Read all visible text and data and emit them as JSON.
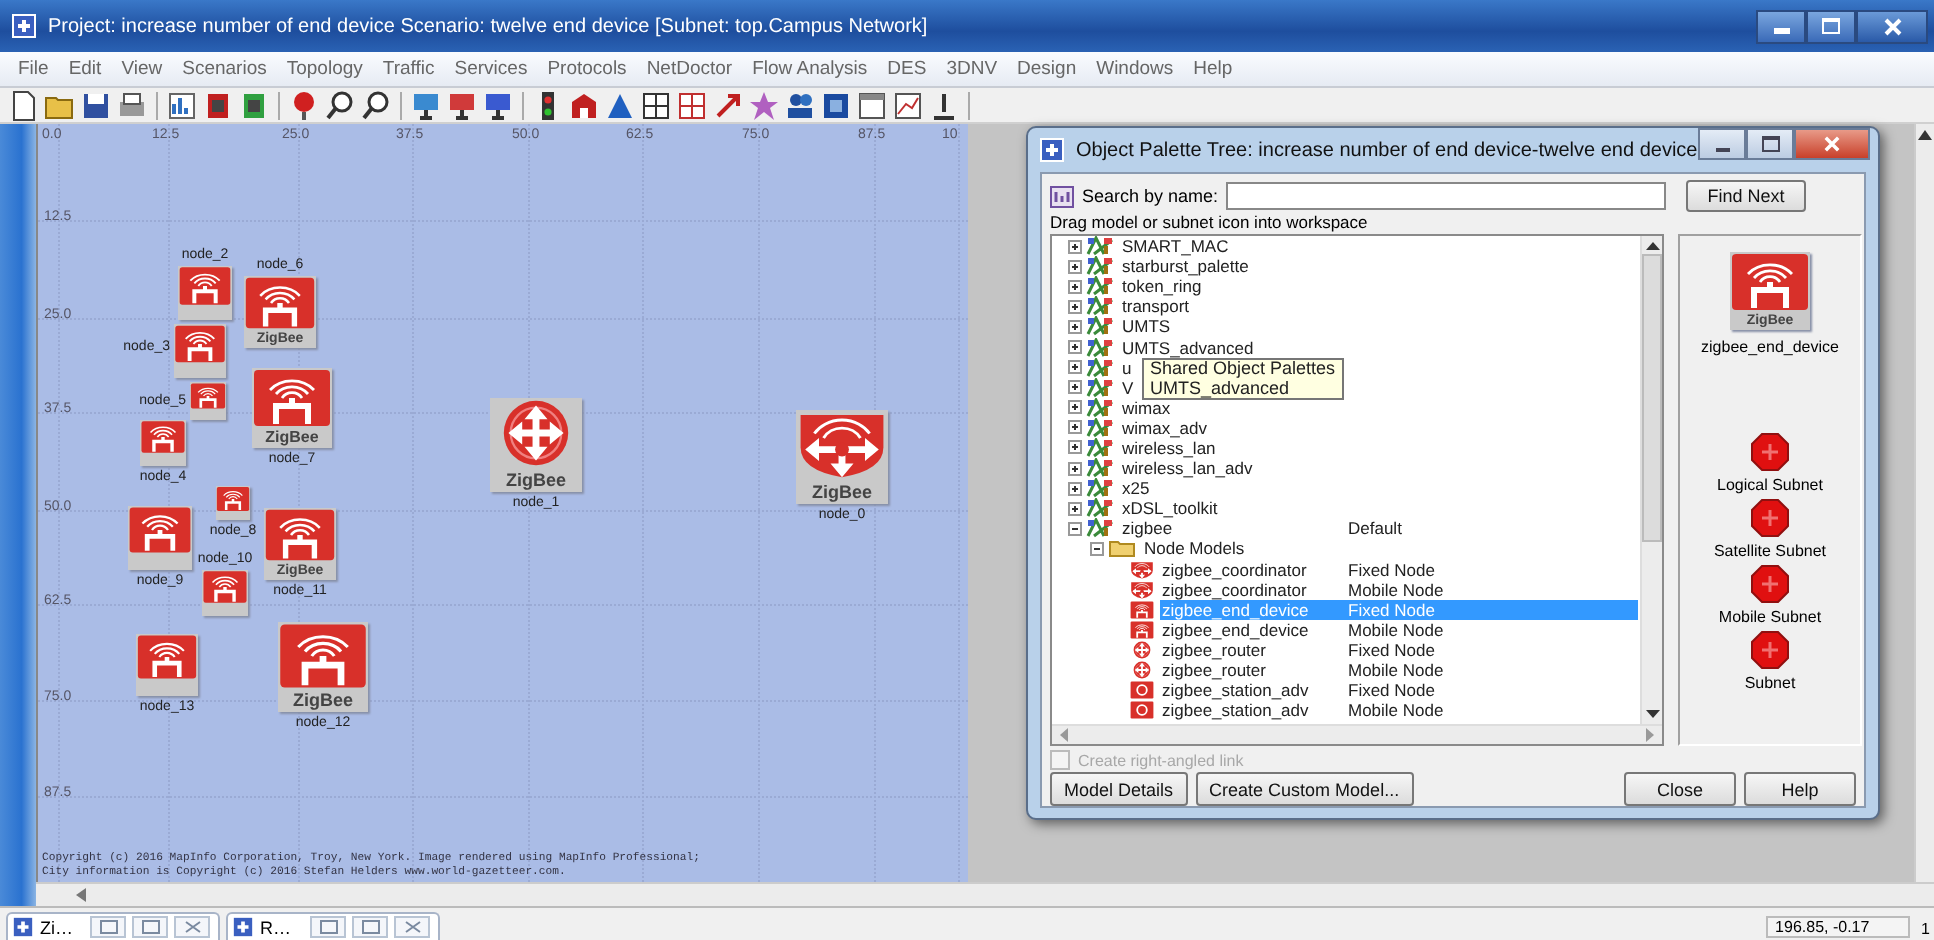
{
  "window": {
    "title": "Project: increase number of end device Scenario: twelve end device  [Subnet: top.Campus Network]"
  },
  "menu": [
    "File",
    "Edit",
    "View",
    "Scenarios",
    "Topology",
    "Traffic",
    "Services",
    "Protocols",
    "NetDoctor",
    "Flow Analysis",
    "DES",
    "3DNV",
    "Design",
    "Windows",
    "Help"
  ],
  "canvas": {
    "x_ticks": [
      "0.0",
      "12.5",
      "25.0",
      "37.5",
      "50.0",
      "62.5",
      "75.0",
      "87.5",
      "10"
    ],
    "y_ticks": [
      "12.5",
      "25.0",
      "37.5",
      "50.0",
      "62.5",
      "75.0",
      "87.5"
    ],
    "nodes": [
      {
        "label": "node_2",
        "kind": "end_device"
      },
      {
        "label": "node_6",
        "kind": "end_device",
        "badge": "ZigBee"
      },
      {
        "label": "node_3",
        "kind": "end_device"
      },
      {
        "label": "node_5",
        "kind": "end_device"
      },
      {
        "label": "node_7",
        "kind": "end_device",
        "badge": "ZigBee"
      },
      {
        "label": "node_4",
        "kind": "end_device"
      },
      {
        "label": "node_1",
        "kind": "router",
        "badge": "ZigBee"
      },
      {
        "label": "node_0",
        "kind": "coordinator",
        "badge": "ZigBee"
      },
      {
        "label": "node_8",
        "kind": "end_device"
      },
      {
        "label": "node_9",
        "kind": "end_device"
      },
      {
        "label": "node_10",
        "kind": "end_device"
      },
      {
        "label": "node_11",
        "kind": "end_device",
        "badge": "ZigBee"
      },
      {
        "label": "node_13",
        "kind": "end_device"
      },
      {
        "label": "node_12",
        "kind": "end_device",
        "badge": "ZigBee"
      }
    ],
    "copyright": [
      "Copyright (c) 2016 MapInfo Corporation, Troy, New York. Image rendered using MapInfo Professional;",
      "City information is Copyright (c) 2016 Stefan Helders www.world-gazetteer.com."
    ]
  },
  "palette_dialog": {
    "title": "Object Palette Tree: increase number of end device-twelve end device",
    "search_label": "Search by name:",
    "find_button": "Find Next",
    "hint": "Drag model or subnet icon into workspace",
    "tree": [
      {
        "label": "SMART_MAC",
        "kind": "palette",
        "expanded": false,
        "selected": false
      },
      {
        "label": "starburst_palette",
        "kind": "palette",
        "expanded": false,
        "selected": false
      },
      {
        "label": "token_ring",
        "kind": "palette",
        "expanded": false,
        "selected": false
      },
      {
        "label": "transport",
        "kind": "palette",
        "expanded": false,
        "selected": false
      },
      {
        "label": "UMTS",
        "kind": "palette",
        "expanded": false,
        "selected": false
      },
      {
        "label": "UMTS_advanced",
        "kind": "palette",
        "expanded": false,
        "selected": false
      },
      {
        "label": "u",
        "kind": "palette",
        "expanded": false,
        "selected": false
      },
      {
        "label": "V",
        "kind": "palette",
        "expanded": false,
        "selected": false
      },
      {
        "label": "wimax",
        "kind": "palette",
        "expanded": false,
        "selected": false
      },
      {
        "label": "wimax_adv",
        "kind": "palette",
        "expanded": false,
        "selected": false
      },
      {
        "label": "wireless_lan",
        "kind": "palette",
        "expanded": false,
        "selected": false
      },
      {
        "label": "wireless_lan_adv",
        "kind": "palette",
        "expanded": false,
        "selected": false
      },
      {
        "label": "x25",
        "kind": "palette",
        "expanded": false,
        "selected": false
      },
      {
        "label": "xDSL_toolkit",
        "kind": "palette",
        "expanded": false,
        "selected": false
      },
      {
        "label": "zigbee",
        "detail": "Default",
        "kind": "palette",
        "expanded": true,
        "selected": false,
        "children": [
          {
            "label": "Node Models",
            "kind": "folder",
            "expanded": true,
            "selected": false,
            "children": [
              {
                "label": "zigbee_coordinator",
                "detail": "Fixed Node",
                "kind": "coordinator",
                "selected": false
              },
              {
                "label": "zigbee_coordinator",
                "detail": "Mobile Node",
                "kind": "coordinator",
                "selected": false
              },
              {
                "label": "zigbee_end_device",
                "detail": "Fixed Node",
                "kind": "end_device",
                "selected": true
              },
              {
                "label": "zigbee_end_device",
                "detail": "Mobile Node",
                "kind": "end_device",
                "selected": false
              },
              {
                "label": "zigbee_router",
                "detail": "Fixed Node",
                "kind": "router",
                "selected": false
              },
              {
                "label": "zigbee_router",
                "detail": "Mobile Node",
                "kind": "router",
                "selected": false
              },
              {
                "label": "zigbee_station_adv",
                "detail": "Fixed Node",
                "kind": "station",
                "selected": false
              },
              {
                "label": "zigbee_station_adv",
                "detail": "Mobile Node",
                "kind": "station",
                "selected": false
              }
            ]
          }
        ]
      }
    ],
    "tooltip": [
      "Shared Object Palettes",
      "UMTS_advanced"
    ],
    "preview": {
      "badge": "ZigBee",
      "label": "zigbee_end_device"
    },
    "subnets": [
      "Logical Subnet",
      "Satellite Subnet",
      "Mobile Subnet",
      "Subnet"
    ],
    "checkbox": {
      "label": "Create right-angled link",
      "checked": false,
      "disabled": true
    },
    "buttons": [
      "Model Details",
      "Create Custom Model...",
      "Close",
      "Help"
    ]
  },
  "taskbar": [
    {
      "label": "Zi…"
    },
    {
      "label": "R…"
    }
  ],
  "status": {
    "coordinates": "196.85, -0.17",
    "column_2": "1"
  }
}
